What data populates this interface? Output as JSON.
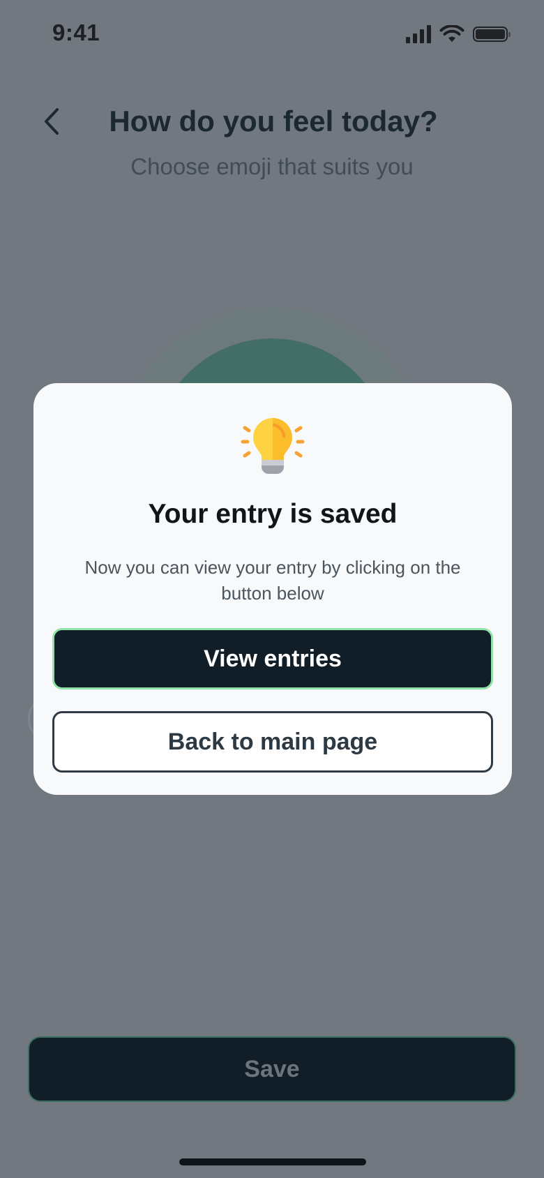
{
  "status_bar": {
    "time": "9:41"
  },
  "header": {
    "title": "How do you feel today?",
    "subtitle": "Choose emoji that suits you"
  },
  "modal": {
    "icon": "lightbulb-icon",
    "title": "Your entry is saved",
    "text": "Now you can view your entry by clicking on the button below",
    "primary_button": "View entries",
    "secondary_button": "Back to main page"
  },
  "footer": {
    "save_label": "Save"
  },
  "colors": {
    "overlay": "#717880",
    "primary_button": "#121e27",
    "accent_border": "#8fe3a8",
    "modal_bg": "#f8f9fb"
  }
}
